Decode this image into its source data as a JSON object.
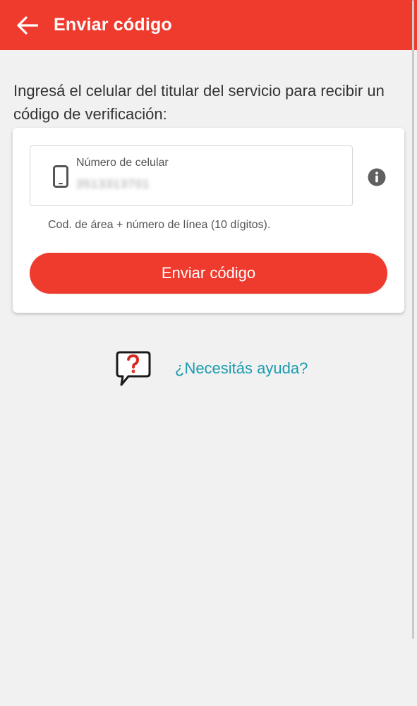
{
  "appbar": {
    "title": "Enviar código",
    "back_icon": "arrow-left-icon",
    "background_color": "#ef3a2e"
  },
  "intro": {
    "text": "Ingresá el celular del titular del servicio para recibir un código de verificación:"
  },
  "form": {
    "phone_label": "Número de celular",
    "phone_value": "3513313701",
    "phone_icon": "smartphone-icon",
    "info_icon": "info-icon",
    "hint": "Cod. de área + número de línea (10 dígitos).",
    "submit_label": "Enviar código"
  },
  "help": {
    "icon": "question-bubble-icon",
    "link_label": "¿Necesitás ayuda?",
    "link_color": "#1c9bb0"
  }
}
